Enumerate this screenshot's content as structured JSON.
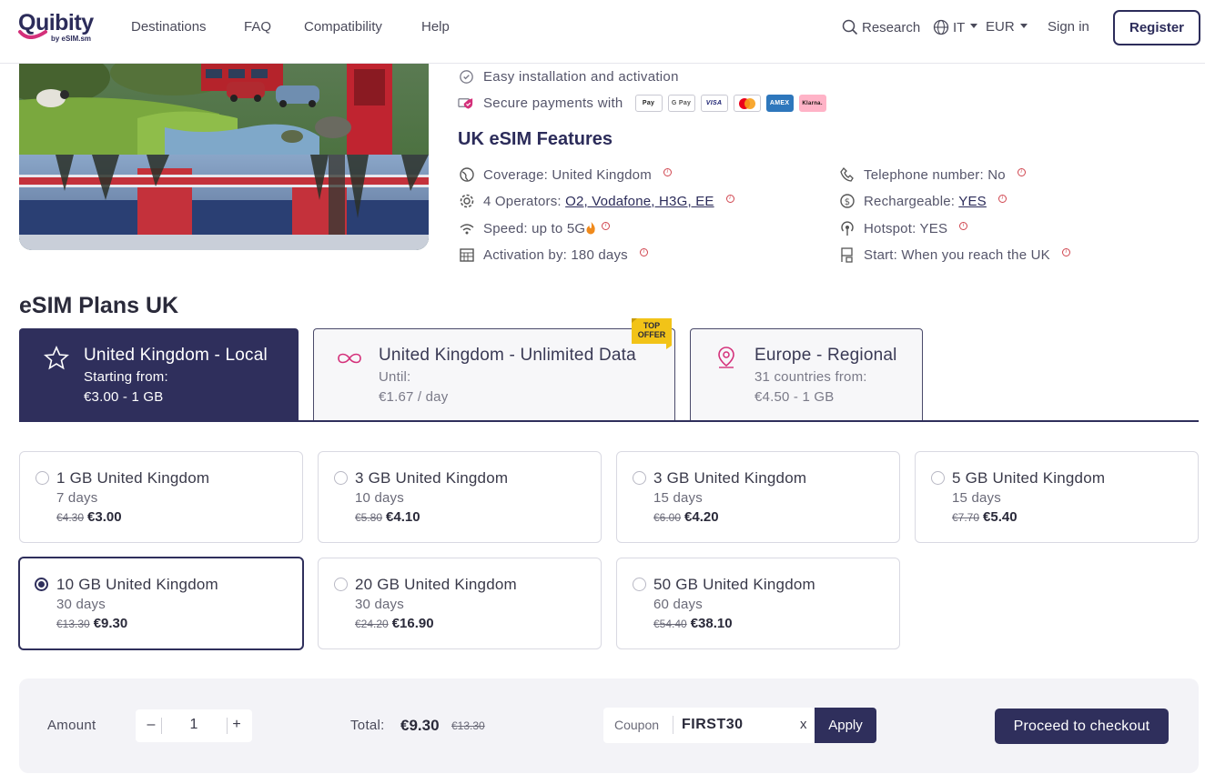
{
  "colors": {
    "brand": "#2f2f5c",
    "accent": "#d4307a",
    "offer": "#f2c318",
    "info": "#d0454f"
  },
  "header": {
    "logo": "Quibity",
    "logo_sub": "by eSIM.sm",
    "nav": [
      "Destinations",
      "FAQ",
      "Compatibility",
      "Help"
    ],
    "search_label": "Research",
    "language": "IT",
    "currency": "EUR",
    "sign_in": "Sign in",
    "register": "Register"
  },
  "info": {
    "easy_install": "Easy installation and activation",
    "secure_payments": "Secure payments with",
    "payment_methods": [
      "Pay",
      "G Pay",
      "VISA",
      "mastercard",
      "AMEX",
      "Klarna."
    ]
  },
  "features": {
    "title": "UK eSIM Features",
    "coverage": "Coverage: United Kingdom",
    "operators_prefix": "4 Operators: ",
    "operators_link": "O2, Vodafone, H3G, EE",
    "speed": "Speed: up to 5G",
    "activation": "Activation by: 180 days",
    "telephone": "Telephone number: No",
    "rechargeable_prefix": "Rechargeable: ",
    "rechargeable_link": "YES",
    "hotspot": "Hotspot: YES",
    "start": "Start: When you reach the UK"
  },
  "plans": {
    "title": "eSIM Plans UK",
    "top_offer": "TOP OFFER",
    "tabs": [
      {
        "title": "United Kingdom - Local",
        "line1": "Starting from:",
        "line2": "€3.00 - 1 GB"
      },
      {
        "title": "United Kingdom - Unlimited Data",
        "line1": "Until:",
        "line2": "€1.67 / day"
      },
      {
        "title": "Europe - Regional",
        "line1": "31 countries from:",
        "line2": "€4.50 - 1 GB"
      }
    ],
    "options": [
      {
        "name": "1 GB United Kingdom",
        "days": "7 days",
        "old": "€4.30",
        "price": "€3.00"
      },
      {
        "name": "3 GB United Kingdom",
        "days": "10 days",
        "old": "€5.80",
        "price": "€4.10"
      },
      {
        "name": "3 GB United Kingdom",
        "days": "15 days",
        "old": "€6.00",
        "price": "€4.20"
      },
      {
        "name": "5 GB United Kingdom",
        "days": "15 days",
        "old": "€7.70",
        "price": "€5.40"
      },
      {
        "name": "10 GB United Kingdom",
        "days": "30 days",
        "old": "€13.30",
        "price": "€9.30",
        "selected": true
      },
      {
        "name": "20 GB United Kingdom",
        "days": "30 days",
        "old": "€24.20",
        "price": "€16.90"
      },
      {
        "name": "50 GB United Kingdom",
        "days": "60 days",
        "old": "€54.40",
        "price": "€38.10"
      }
    ]
  },
  "checkout": {
    "amount_label": "Amount",
    "minus": "–",
    "quantity": "1",
    "plus": "+",
    "total_label": "Total:",
    "total": "€9.30",
    "total_old": "€13.30",
    "coupon_label": "Coupon",
    "coupon_value": "FIRST30",
    "coupon_clear": "x",
    "apply": "Apply",
    "proceed": "Proceed to checkout"
  }
}
